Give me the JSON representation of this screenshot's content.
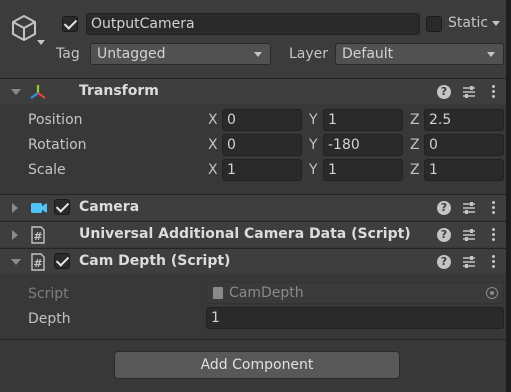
{
  "header": {
    "name_value": "OutputCamera",
    "active_checked": true,
    "static_label": "Static",
    "static_checked": false,
    "tag_label": "Tag",
    "tag_value": "Untagged",
    "layer_label": "Layer",
    "layer_value": "Default"
  },
  "components": {
    "transform": {
      "title": "Transform",
      "expanded": true,
      "position_label": "Position",
      "rotation_label": "Rotation",
      "scale_label": "Scale",
      "axis_x": "X",
      "axis_y": "Y",
      "axis_z": "Z",
      "position": {
        "x": "0",
        "y": "1",
        "z": "2.5"
      },
      "rotation": {
        "x": "0",
        "y": "-180",
        "z": "0"
      },
      "scale": {
        "x": "1",
        "y": "1",
        "z": "1"
      }
    },
    "camera": {
      "title": "Camera",
      "enabled": true,
      "expanded": false
    },
    "urp_data": {
      "title": "Universal Additional Camera Data (Script)",
      "expanded": false
    },
    "cam_depth": {
      "title": "Cam Depth (Script)",
      "enabled": true,
      "expanded": true,
      "script_label": "Script",
      "script_value": "CamDepth",
      "depth_label": "Depth",
      "depth_value": "1"
    }
  },
  "add_component_label": "Add Component",
  "icons": {
    "gameobject": "cube-icon",
    "transform": "transform-axes-icon",
    "camera": "camera-icon",
    "script": "script-hash-icon",
    "help": "help-icon",
    "presets": "presets-icon",
    "menu": "kebab-menu-icon"
  },
  "colors": {
    "background": "#383838",
    "component_header": "#3e3e3e",
    "field": "#2a2a2a",
    "camera_icon": "#4fc3f7"
  }
}
